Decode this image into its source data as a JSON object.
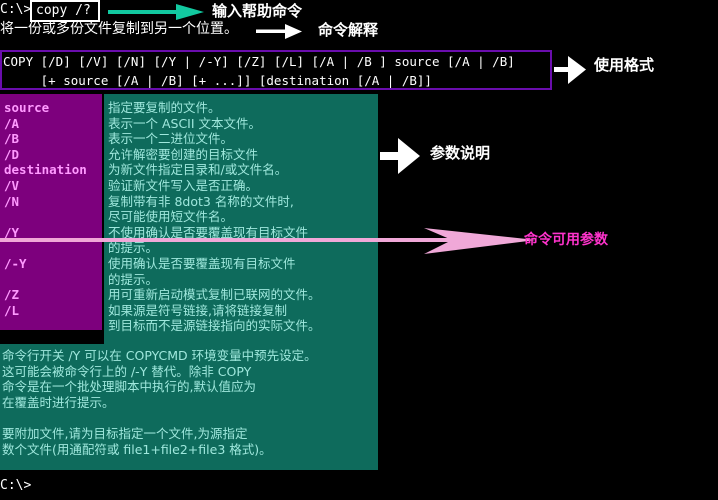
{
  "terminal": {
    "prompt_top": "C:\\>",
    "typed_command": "copy /?",
    "prompt_bottom": "C:\\>",
    "intro_line": "将一份或多份文件复制到另一个位置。",
    "syntax_line_1": "COPY [/D] [/V] [/N] [/Y | /-Y] [/Z] [/L] [/A | /B ] source [/A | /B]",
    "syntax_line_2": "     [+ source [/A | /B] [+ ...]] [destination [/A | /B]]"
  },
  "params_panel": {
    "items": [
      "source",
      "/A",
      "/B",
      "/D",
      "destination",
      "/V",
      "/N",
      "",
      "/Y",
      "",
      "/-Y",
      "",
      "/Z",
      "/L"
    ]
  },
  "desc_panel": {
    "lines": [
      "指定要复制的文件。",
      "表示一个 ASCII 文本文件。",
      "表示一个二进位文件。",
      "允许解密要创建的目标文件",
      "为新文件指定目录和/或文件名。",
      "验证新文件写入是否正确。",
      "复制带有非 8dot3 名称的文件时,",
      "尽可能使用短文件名。",
      "不使用确认是否要覆盖现有目标文件",
      "的提示。",
      "使用确认是否要覆盖现有目标文件",
      "的提示。",
      "用可重新启动模式复制已联网的文件。",
      "如果源是符号链接,请将链接复制",
      "到目标而不是源链接指向的实际文件。"
    ]
  },
  "note_panel": {
    "lines": [
      "命令行开关 /Y 可以在 COPYCMD 环境变量中预先设定。",
      "这可能会被命令行上的 /-Y 替代。除非 COPY",
      "命令是在一个批处理脚本中执行的,默认值应为",
      "在覆盖时进行提示。",
      "",
      "要附加文件,请为目标指定一个文件,为源指定",
      "数个文件(用通配符或 file1+file2+file3 格式)。"
    ]
  },
  "annotations": [
    {
      "id": "input-help-command",
      "label": "输入帮助命令",
      "color": "#ffffff",
      "arrow": "teal-arrow-right"
    },
    {
      "id": "command-explanation",
      "label": "命令解释",
      "color": "#ffffff",
      "arrow": "white-arrow-right"
    },
    {
      "id": "usage-format",
      "label": "使用格式",
      "color": "#ffffff",
      "arrow": "white-arrow-right"
    },
    {
      "id": "parameter-description",
      "label": "参数说明",
      "color": "#ffffff",
      "arrow": "white-arrow-right"
    },
    {
      "id": "available-parameters",
      "label": "命令可用参数",
      "color": "#ff33cc",
      "arrow": "pink-arrow-right"
    }
  ],
  "colors": {
    "background": "#000000",
    "purple_panel": "#7d007d",
    "purple_text": "#ff99ff",
    "teal_panel": "#0e6b5c",
    "teal_text": "#9fe8dd",
    "syntax_border": "#6a0dad",
    "teal_arrow": "#12c9a0",
    "pink_arrow": "#f0a8d8",
    "magenta_label": "#ff33cc"
  }
}
